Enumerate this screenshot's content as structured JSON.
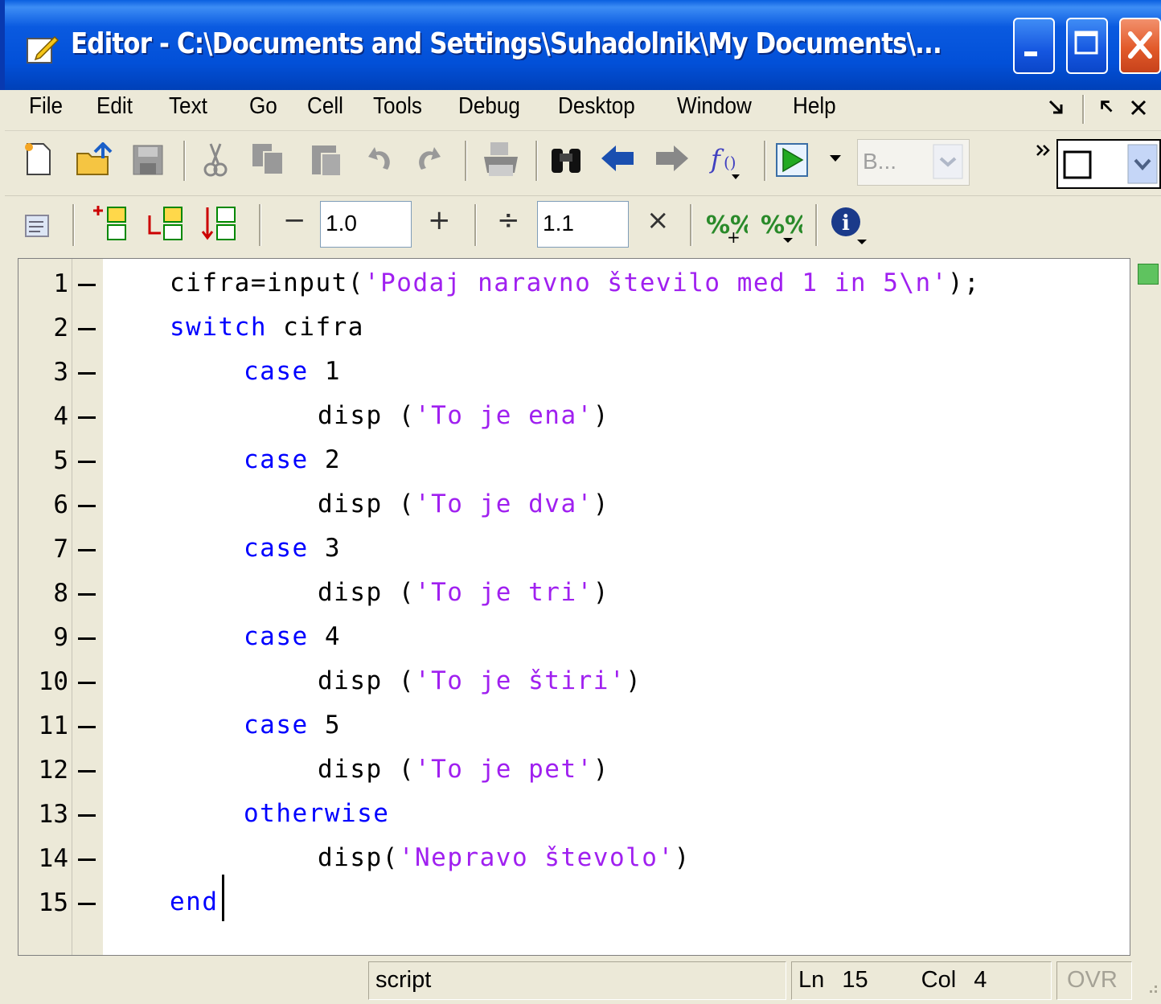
{
  "window": {
    "title": "Editor - C:\\Documents and Settings\\Suhadolnik\\My Documents\\..."
  },
  "menu": {
    "items": [
      "File",
      "Edit",
      "Text",
      "Go",
      "Cell",
      "Tools",
      "Debug",
      "Desktop",
      "Window",
      "Help"
    ]
  },
  "toolbar": {
    "stack_placeholder": "B...",
    "cell_decrement_label": "−",
    "cell_value": "1.0",
    "cell_increment_label": "+",
    "cell_divide_label": "÷",
    "cell_value2": "1.1",
    "cell_multiply_label": "×"
  },
  "editor": {
    "lines": [
      {
        "num": "1",
        "code": "cifra=input('Podaj naravno število med 1 in 5\\n');"
      },
      {
        "num": "2",
        "code": "switch cifra"
      },
      {
        "num": "3",
        "code": "case 1"
      },
      {
        "num": "4",
        "code": "disp ('To je ena')"
      },
      {
        "num": "5",
        "code": "case 2"
      },
      {
        "num": "6",
        "code": "disp ('To je dva')"
      },
      {
        "num": "7",
        "code": "case 3"
      },
      {
        "num": "8",
        "code": "disp ('To je tri')"
      },
      {
        "num": "9",
        "code": "case 4"
      },
      {
        "num": "10",
        "code": "disp ('To je štiri')"
      },
      {
        "num": "11",
        "code": "case 5"
      },
      {
        "num": "12",
        "code": "disp ('To je pet')"
      },
      {
        "num": "13",
        "code": "otherwise"
      },
      {
        "num": "14",
        "code": "disp('Nepravo števolo')"
      },
      {
        "num": "15",
        "code": "end"
      }
    ]
  },
  "statusbar": {
    "mode": "script",
    "ln_label": "Ln",
    "ln_value": "15",
    "col_label": "Col",
    "col_value": "4",
    "ovr": "OVR"
  },
  "colors": {
    "keyword": "#0000ff",
    "string": "#a020f0",
    "titlebar": "#0250d8"
  }
}
